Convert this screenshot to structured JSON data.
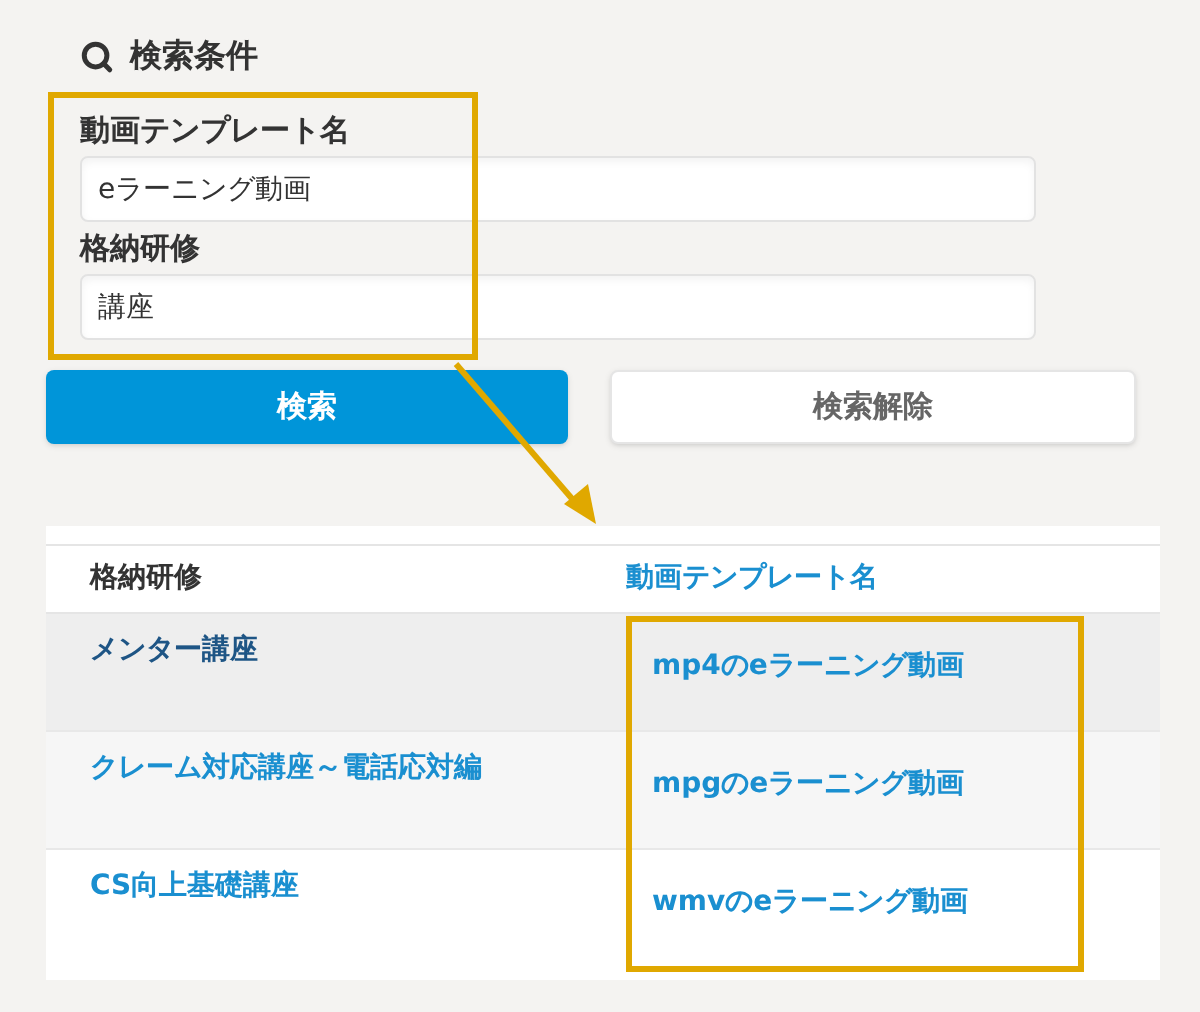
{
  "search_panel": {
    "title": "検索条件",
    "fields": [
      {
        "label": "動画テンプレート名",
        "value": "eラーニング動画"
      },
      {
        "label": "格納研修",
        "value": "講座"
      }
    ],
    "buttons": [
      {
        "label": "検索",
        "kind": "primary"
      },
      {
        "label": "検索解除",
        "kind": "secondary"
      }
    ]
  },
  "table": {
    "columns": [
      "格納研修",
      "動画テンプレート名"
    ],
    "rows": [
      {
        "course": "メンター講座",
        "template": "mp4のeラーニング動画",
        "hovered": true
      },
      {
        "course": "クレーム対応講座～電話応対編",
        "template": "mpgのeラーニング動画",
        "hovered": false
      },
      {
        "course": "CS向上基礎講座",
        "template": "wmvのeラーニング動画",
        "hovered": false
      }
    ]
  }
}
